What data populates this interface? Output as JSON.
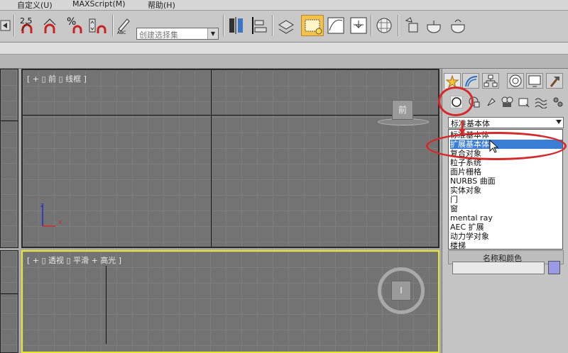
{
  "menu": {
    "items": [
      "自定义(U)",
      "MAXScript(M)",
      "帮助(H)"
    ]
  },
  "toolbar": {
    "selection_set_placeholder": "创建选择集",
    "snap_labels": [
      "2.5",
      "%"
    ],
    "abc_label": "ABC"
  },
  "viewports": {
    "front": {
      "label": "[ + ▯ 前 ▯ 线框 ]",
      "cube_label": "前",
      "axis_labels": [
        "z",
        "x"
      ]
    },
    "perspective": {
      "label": "[ + ▯ 透视 ▯ 平滑 + 高光 ]",
      "cube_label": "I"
    }
  },
  "command_panel": {
    "tabs": [
      "create-tab",
      "modify-tab",
      "hierarchy-tab",
      "motion-tab",
      "display-tab",
      "utilities-tab"
    ],
    "subcategories": [
      "geometry",
      "shapes",
      "lights",
      "cameras",
      "helpers",
      "space-warps",
      "systems"
    ],
    "dropdown": {
      "selected": "标准基本体",
      "options": [
        "标准基本体",
        "扩展基本体",
        "复合对象",
        "粒子系统",
        "面片栅格",
        "NURBS 曲面",
        "实体对象",
        "门",
        "窗",
        "mental ray",
        "AEC 扩展",
        "动力学对象",
        "楼梯"
      ],
      "highlighted": "扩展基本体"
    },
    "lower_rollout_label": "名称和颜色",
    "name_value": "",
    "swatch_color": "#9a9ae8"
  },
  "colors": {
    "annotation": "#d42a2a",
    "highlight": "#3a7fd5",
    "active_viewport_border": "#e6e62a"
  }
}
